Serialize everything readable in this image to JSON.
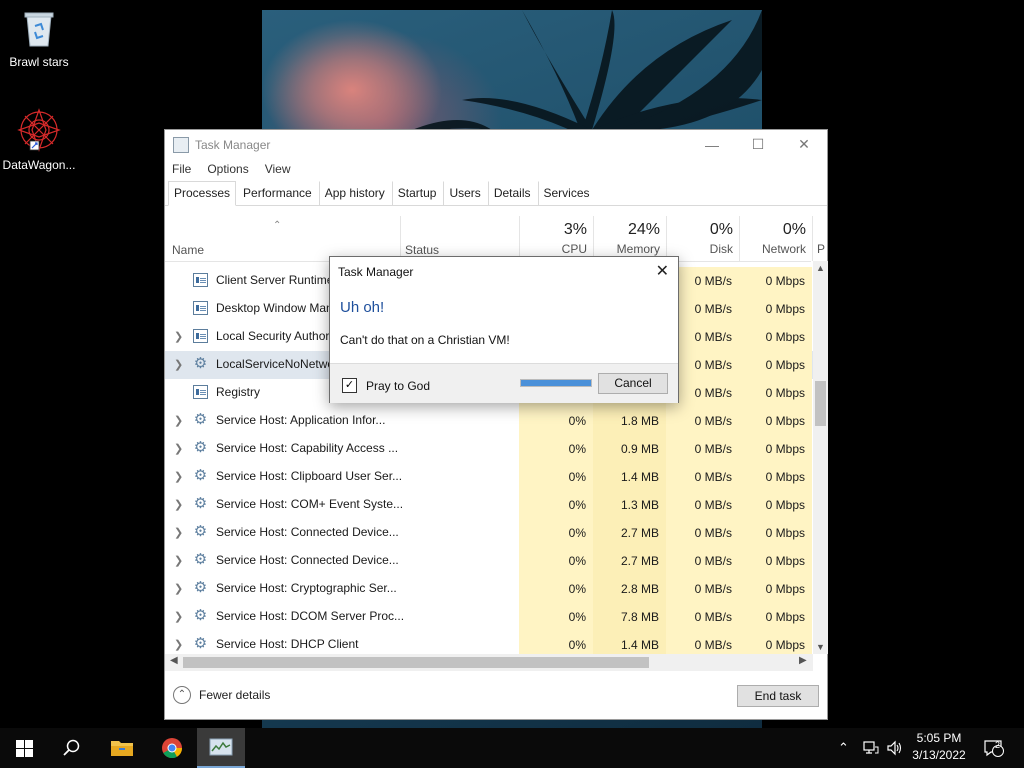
{
  "desktop": {
    "icons": [
      {
        "label": "Brawl stars"
      },
      {
        "label": "DataWagon..."
      }
    ]
  },
  "task_manager": {
    "title": "Task Manager",
    "menu": [
      "File",
      "Options",
      "View"
    ],
    "tabs": [
      "Processes",
      "Performance",
      "App history",
      "Startup",
      "Users",
      "Details",
      "Services"
    ],
    "active_tab": "Processes",
    "columns": {
      "name": "Name",
      "status": "Status",
      "cpu": {
        "pct": "3%",
        "label": "CPU"
      },
      "memory": {
        "pct": "24%",
        "label": "Memory"
      },
      "disk": {
        "pct": "0%",
        "label": "Disk"
      },
      "network": {
        "pct": "0%",
        "label": "Network"
      },
      "power": "P"
    },
    "rows": [
      {
        "name": "Client Server Runtime Process",
        "expandable": false,
        "icon": "window-icon",
        "cpu": "",
        "mem": "",
        "disk": "0 MB/s",
        "net": "0 Mbps"
      },
      {
        "name": "Desktop Window Manager",
        "expandable": false,
        "icon": "window-icon",
        "cpu": "",
        "mem": "",
        "disk": "0 MB/s",
        "net": "0 Mbps"
      },
      {
        "name": "Local Security Authority",
        "expandable": true,
        "icon": "window-icon",
        "cpu": "",
        "mem": "",
        "disk": "0 MB/s",
        "net": "0 Mbps"
      },
      {
        "name": "LocalServiceNoNetwork",
        "expandable": true,
        "icon": "gear-icon",
        "cpu": "",
        "mem": "",
        "disk": "0 MB/s",
        "net": "0 Mbps"
      },
      {
        "name": "Registry",
        "expandable": false,
        "icon": "window-icon",
        "cpu": "",
        "mem": "",
        "disk": "0 MB/s",
        "net": "0 Mbps"
      },
      {
        "name": "Service Host: Application Infor...",
        "expandable": true,
        "icon": "gear-icon",
        "cpu": "0%",
        "mem": "1.8 MB",
        "disk": "0 MB/s",
        "net": "0 Mbps"
      },
      {
        "name": "Service Host: Capability Access ...",
        "expandable": true,
        "icon": "gear-icon",
        "cpu": "0%",
        "mem": "0.9 MB",
        "disk": "0 MB/s",
        "net": "0 Mbps"
      },
      {
        "name": "Service Host: Clipboard User Ser...",
        "expandable": true,
        "icon": "gear-icon",
        "cpu": "0%",
        "mem": "1.4 MB",
        "disk": "0 MB/s",
        "net": "0 Mbps"
      },
      {
        "name": "Service Host: COM+ Event Syste...",
        "expandable": true,
        "icon": "gear-icon",
        "cpu": "0%",
        "mem": "1.3 MB",
        "disk": "0 MB/s",
        "net": "0 Mbps"
      },
      {
        "name": "Service Host: Connected Device...",
        "expandable": true,
        "icon": "gear-icon",
        "cpu": "0%",
        "mem": "2.7 MB",
        "disk": "0 MB/s",
        "net": "0 Mbps"
      },
      {
        "name": "Service Host: Connected Device...",
        "expandable": true,
        "icon": "gear-icon",
        "cpu": "0%",
        "mem": "2.7 MB",
        "disk": "0 MB/s",
        "net": "0 Mbps"
      },
      {
        "name": "Service Host: Cryptographic Ser...",
        "expandable": true,
        "icon": "gear-icon",
        "cpu": "0%",
        "mem": "2.8 MB",
        "disk": "0 MB/s",
        "net": "0 Mbps"
      },
      {
        "name": "Service Host: DCOM Server Proc...",
        "expandable": true,
        "icon": "gear-icon",
        "cpu": "0%",
        "mem": "7.8 MB",
        "disk": "0 MB/s",
        "net": "0 Mbps"
      },
      {
        "name": "Service Host: DHCP Client",
        "expandable": true,
        "icon": "gear-icon",
        "cpu": "0%",
        "mem": "1.4 MB",
        "disk": "0 MB/s",
        "net": "0 Mbps"
      }
    ],
    "footer": {
      "fewer_details": "Fewer details",
      "end_task": "End task"
    }
  },
  "dialog": {
    "title": "Task Manager",
    "heading": "Uh oh!",
    "message": "Can't do that on a Christian VM!",
    "checkbox_label": "Pray to God",
    "checkbox_checked": true,
    "progress": 1.0,
    "cancel": "Cancel"
  },
  "taskbar": {
    "time": "5:05 PM",
    "date": "3/13/2022",
    "notification_count": "2",
    "accent": "#7aa7d6"
  }
}
